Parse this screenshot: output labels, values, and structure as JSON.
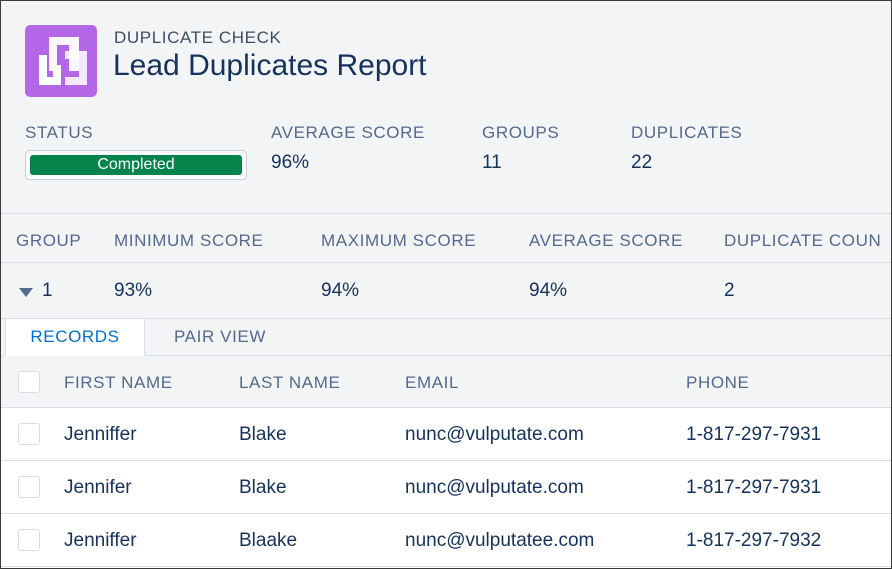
{
  "header": {
    "eyebrow": "DUPLICATE CHECK",
    "title": "Lead Duplicates Report",
    "logo_icon": "duplicate-check-logo-icon",
    "logo_color": "#b366e6"
  },
  "summary": {
    "status_label": "STATUS",
    "status_value": "Completed",
    "status_progress": 1.0,
    "status_color": "#04844b",
    "average_score_label": "AVERAGE SCORE",
    "average_score_value": "96%",
    "groups_label": "GROUPS",
    "groups_value": "11",
    "duplicates_label": "DUPLICATES",
    "duplicates_value": "22"
  },
  "group_table": {
    "columns": [
      "GROUP",
      "MINIMUM SCORE",
      "MAXIMUM SCORE",
      "AVERAGE SCORE",
      "DUPLICATE COUN"
    ],
    "rows": [
      {
        "group": "1",
        "min": "93%",
        "max": "94%",
        "avg": "94%",
        "count": "2",
        "expanded": true
      }
    ]
  },
  "tabs": [
    {
      "label": "RECORDS",
      "active": true
    },
    {
      "label": "PAIR VIEW",
      "active": false
    }
  ],
  "records": {
    "columns": [
      "FIRST NAME",
      "LAST NAME",
      "EMAIL",
      "PHONE"
    ],
    "rows": [
      {
        "first": "Jenniffer",
        "last": "Blake",
        "email": "nunc@vulputate.com",
        "phone": "1-817-297-7931"
      },
      {
        "first": "Jennifer",
        "last": "Blake",
        "email": "nunc@vulputate.com",
        "phone": "1-817-297-7931"
      },
      {
        "first": "Jenniffer",
        "last": "Blaake",
        "email": "nunc@vulputatee.com",
        "phone": "1-817-297-7932"
      }
    ]
  }
}
